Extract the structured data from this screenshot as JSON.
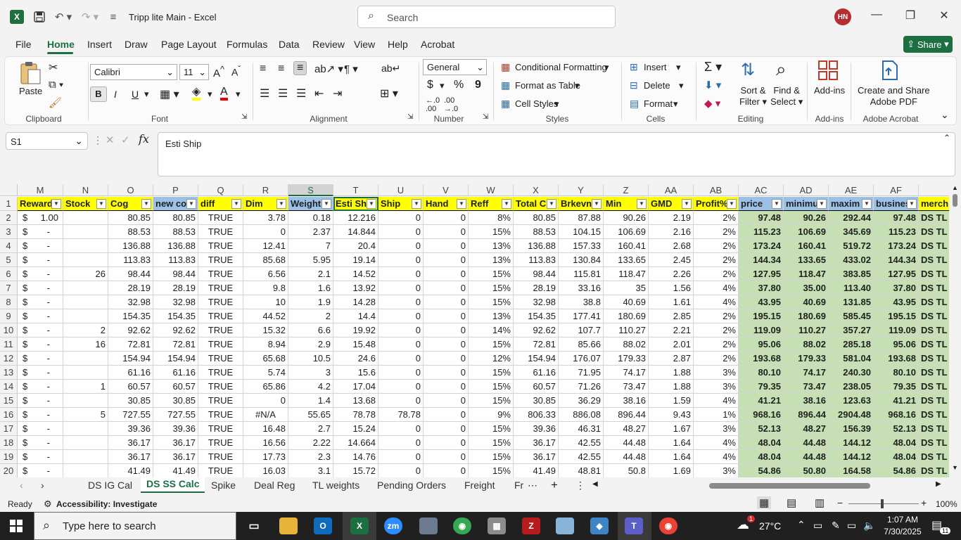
{
  "titlebar": {
    "app_letter": "X",
    "doc_title": "Tripp lite Main  -  Excel",
    "search_placeholder": "Search",
    "avatar_initials": "HN",
    "save_icon": "save-icon",
    "undo_icon": "undo-icon",
    "redo_icon": "redo-icon"
  },
  "tabs": [
    "File",
    "Home",
    "Insert",
    "Draw",
    "Page Layout",
    "Formulas",
    "Data",
    "Review",
    "View",
    "Help",
    "Acrobat"
  ],
  "active_tab": "Home",
  "share_label": "Share",
  "ribbon": {
    "clipboard": {
      "paste": "Paste",
      "label": "Clipboard"
    },
    "font": {
      "name": "Calibri",
      "size": "11",
      "bold": "B",
      "italic": "I",
      "underline": "U",
      "label": "Font"
    },
    "alignment": {
      "label": "Alignment"
    },
    "number": {
      "format": "General",
      "currency": "$",
      "percent": "%",
      "comma": "9",
      "label": "Number"
    },
    "styles": {
      "cond": "Conditional Formatting",
      "table": "Format as Table",
      "cell": "Cell Styles",
      "label": "Styles"
    },
    "cells": {
      "insert": "Insert",
      "delete": "Delete",
      "format": "Format",
      "label": "Cells"
    },
    "editing": {
      "sort": "Sort &",
      "filter": "Filter",
      "find": "Find &",
      "select": "Select",
      "label": "Editing"
    },
    "addins": {
      "btn": "Add-ins",
      "label": "Add-ins"
    },
    "acrobat": {
      "line1": "Create and Share",
      "line2": "Adobe PDF",
      "label": "Adobe Acrobat"
    }
  },
  "formula_bar": {
    "namebox": "S1",
    "fx": "fx",
    "content": "Esti Ship"
  },
  "columns": [
    "M",
    "N",
    "O",
    "P",
    "Q",
    "R",
    "S",
    "T",
    "U",
    "V",
    "W",
    "X",
    "Y",
    "Z",
    "AA",
    "AB",
    "AC",
    "AD",
    "AE",
    "AF",
    ""
  ],
  "headers": [
    "Reward",
    "Stock",
    "Cog",
    "new co",
    "diff",
    "Dim",
    "Weight",
    "Esti Shi",
    "Ship",
    "Hand",
    "Reff",
    "Total C",
    "Brkevn",
    "Min",
    "GMD",
    "Profit%",
    "price",
    "minimu",
    "maxim",
    "busines",
    "merch"
  ],
  "rows": [
    [
      "2",
      "$",
      "1.00",
      "",
      "80.85",
      "80.85",
      "TRUE",
      "3.78",
      "0.18",
      "12.216",
      "0",
      "0",
      "8%",
      "80.85",
      "87.88",
      "90.26",
      "2.19",
      "2%",
      "97.48",
      "90.26",
      "292.44",
      "97.48",
      "DS TL"
    ],
    [
      "3",
      "$",
      "-",
      "",
      "88.53",
      "88.53",
      "TRUE",
      "0",
      "2.37",
      "14.844",
      "0",
      "0",
      "15%",
      "88.53",
      "104.15",
      "106.69",
      "2.16",
      "2%",
      "115.23",
      "106.69",
      "345.69",
      "115.23",
      "DS TL"
    ],
    [
      "4",
      "$",
      "-",
      "",
      "136.88",
      "136.88",
      "TRUE",
      "12.41",
      "7",
      "20.4",
      "0",
      "0",
      "13%",
      "136.88",
      "157.33",
      "160.41",
      "2.68",
      "2%",
      "173.24",
      "160.41",
      "519.72",
      "173.24",
      "DS TL"
    ],
    [
      "5",
      "$",
      "-",
      "",
      "113.83",
      "113.83",
      "TRUE",
      "85.68",
      "5.95",
      "19.14",
      "0",
      "0",
      "13%",
      "113.83",
      "130.84",
      "133.65",
      "2.45",
      "2%",
      "144.34",
      "133.65",
      "433.02",
      "144.34",
      "DS TL"
    ],
    [
      "6",
      "$",
      "-",
      "26",
      "98.44",
      "98.44",
      "TRUE",
      "6.56",
      "2.1",
      "14.52",
      "0",
      "0",
      "15%",
      "98.44",
      "115.81",
      "118.47",
      "2.26",
      "2%",
      "127.95",
      "118.47",
      "383.85",
      "127.95",
      "DS TL"
    ],
    [
      "7",
      "$",
      "-",
      "",
      "28.19",
      "28.19",
      "TRUE",
      "9.8",
      "1.6",
      "13.92",
      "0",
      "0",
      "15%",
      "28.19",
      "33.16",
      "35",
      "1.56",
      "4%",
      "37.80",
      "35.00",
      "113.40",
      "37.80",
      "DS TL"
    ],
    [
      "8",
      "$",
      "-",
      "",
      "32.98",
      "32.98",
      "TRUE",
      "10",
      "1.9",
      "14.28",
      "0",
      "0",
      "15%",
      "32.98",
      "38.8",
      "40.69",
      "1.61",
      "4%",
      "43.95",
      "40.69",
      "131.85",
      "43.95",
      "DS TL"
    ],
    [
      "9",
      "$",
      "-",
      "",
      "154.35",
      "154.35",
      "TRUE",
      "44.52",
      "2",
      "14.4",
      "0",
      "0",
      "13%",
      "154.35",
      "177.41",
      "180.69",
      "2.85",
      "2%",
      "195.15",
      "180.69",
      "585.45",
      "195.15",
      "DS TL"
    ],
    [
      "10",
      "$",
      "-",
      "2",
      "92.62",
      "92.62",
      "TRUE",
      "15.32",
      "6.6",
      "19.92",
      "0",
      "0",
      "14%",
      "92.62",
      "107.7",
      "110.27",
      "2.21",
      "2%",
      "119.09",
      "110.27",
      "357.27",
      "119.09",
      "DS TL"
    ],
    [
      "11",
      "$",
      "-",
      "16",
      "72.81",
      "72.81",
      "TRUE",
      "8.94",
      "2.9",
      "15.48",
      "0",
      "0",
      "15%",
      "72.81",
      "85.66",
      "88.02",
      "2.01",
      "2%",
      "95.06",
      "88.02",
      "285.18",
      "95.06",
      "DS TL"
    ],
    [
      "12",
      "$",
      "-",
      "",
      "154.94",
      "154.94",
      "TRUE",
      "65.68",
      "10.5",
      "24.6",
      "0",
      "0",
      "12%",
      "154.94",
      "176.07",
      "179.33",
      "2.87",
      "2%",
      "193.68",
      "179.33",
      "581.04",
      "193.68",
      "DS TL"
    ],
    [
      "13",
      "$",
      "-",
      "",
      "61.16",
      "61.16",
      "TRUE",
      "5.74",
      "3",
      "15.6",
      "0",
      "0",
      "15%",
      "61.16",
      "71.95",
      "74.17",
      "1.88",
      "3%",
      "80.10",
      "74.17",
      "240.30",
      "80.10",
      "DS TL"
    ],
    [
      "14",
      "$",
      "-",
      "1",
      "60.57",
      "60.57",
      "TRUE",
      "65.86",
      "4.2",
      "17.04",
      "0",
      "0",
      "15%",
      "60.57",
      "71.26",
      "73.47",
      "1.88",
      "3%",
      "79.35",
      "73.47",
      "238.05",
      "79.35",
      "DS TL"
    ],
    [
      "15",
      "$",
      "-",
      "",
      "30.85",
      "30.85",
      "TRUE",
      "0",
      "1.4",
      "13.68",
      "0",
      "0",
      "15%",
      "30.85",
      "36.29",
      "38.16",
      "1.59",
      "4%",
      "41.21",
      "38.16",
      "123.63",
      "41.21",
      "DS TL"
    ],
    [
      "16",
      "$",
      "-",
      "5",
      "727.55",
      "727.55",
      "TRUE",
      "#N/A",
      "55.65",
      "78.78",
      "78.78",
      "0",
      "9%",
      "806.33",
      "886.08",
      "896.44",
      "9.43",
      "1%",
      "968.16",
      "896.44",
      "2904.48",
      "968.16",
      "DS TL"
    ],
    [
      "17",
      "$",
      "-",
      "",
      "39.36",
      "39.36",
      "TRUE",
      "16.48",
      "2.7",
      "15.24",
      "0",
      "0",
      "15%",
      "39.36",
      "46.31",
      "48.27",
      "1.67",
      "3%",
      "52.13",
      "48.27",
      "156.39",
      "52.13",
      "DS TL"
    ],
    [
      "18",
      "$",
      "-",
      "",
      "36.17",
      "36.17",
      "TRUE",
      "16.56",
      "2.22",
      "14.664",
      "0",
      "0",
      "15%",
      "36.17",
      "42.55",
      "44.48",
      "1.64",
      "4%",
      "48.04",
      "44.48",
      "144.12",
      "48.04",
      "DS TL"
    ],
    [
      "19",
      "$",
      "-",
      "",
      "36.17",
      "36.17",
      "TRUE",
      "17.73",
      "2.3",
      "14.76",
      "0",
      "0",
      "15%",
      "36.17",
      "42.55",
      "44.48",
      "1.64",
      "4%",
      "48.04",
      "44.48",
      "144.12",
      "48.04",
      "DS TL"
    ],
    [
      "20",
      "$",
      "-",
      "",
      "41.49",
      "41.49",
      "TRUE",
      "16.03",
      "3.1",
      "15.72",
      "0",
      "0",
      "15%",
      "41.49",
      "48.81",
      "50.8",
      "1.69",
      "3%",
      "54.86",
      "50.80",
      "164.58",
      "54.86",
      "DS TL"
    ]
  ],
  "sheets": [
    "DS IG Cal",
    "DS SS Calc",
    "Spike",
    "Deal Reg",
    "TL weights",
    "Pending Orders",
    "Freight",
    "Fr"
  ],
  "active_sheet": "DS SS Calc",
  "status": {
    "ready": "Ready",
    "accessibility": "Accessibility: Investigate",
    "zoom": "100%"
  },
  "taskbar": {
    "search_placeholder": "Type here to search",
    "temp": "27°C",
    "time": "1:07 AM",
    "date": "7/30/2025",
    "weather_badge": "1",
    "notif_count": "11"
  },
  "colors": {
    "excel_green": "#1d6f42",
    "header_yellow": "#ffff00",
    "header_blue": "#9bc2e6",
    "price_green": "#c6e0b4"
  }
}
